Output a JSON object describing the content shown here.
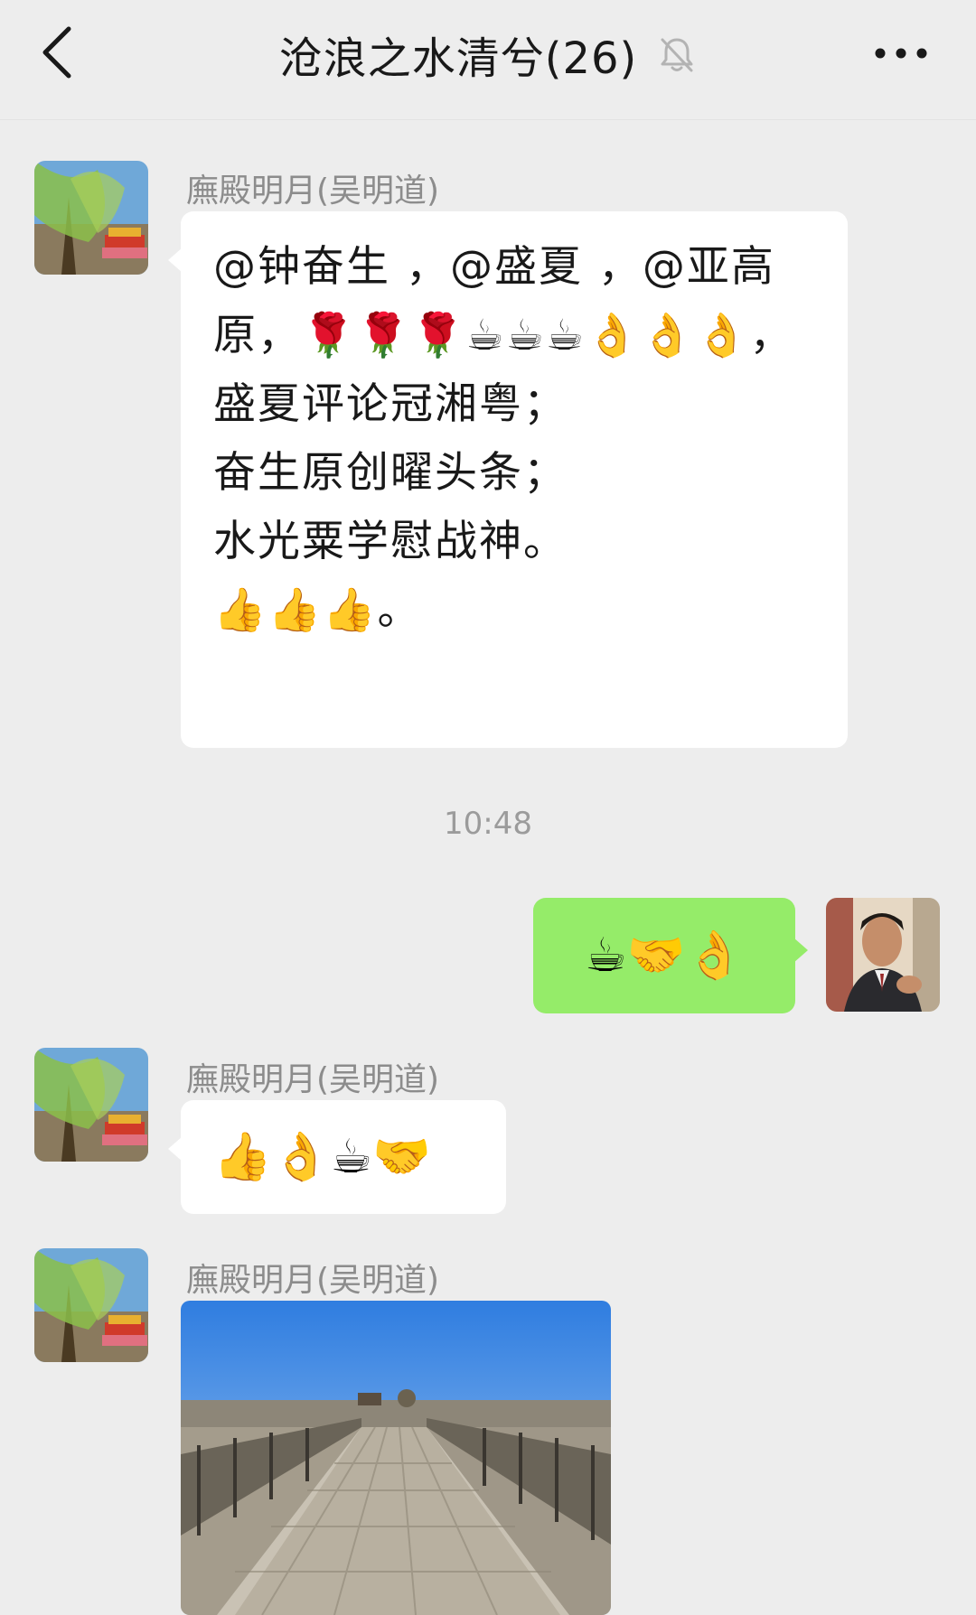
{
  "header": {
    "title": "沧浪之水清兮(26)",
    "back_icon": "chevron-left-icon",
    "mute_icon": "bell-off-icon",
    "more_icon": "more-dots-icon"
  },
  "messages": [
    {
      "sender": "廡殿明月(吴明道)",
      "text": "@钟奋生 ，@盛夏 ，@亚高原，🌹🌹🌹☕☕☕👌👌👌，\n盛夏评论冠湘粤；\n奋生原创曜头条；\n水光粟学慰战神。\n👍👍👍。"
    },
    {
      "timestamp": "10:48"
    },
    {
      "sender": "me",
      "text": "☕🤝👌"
    },
    {
      "sender": "廡殿明月(吴明道)",
      "text": "👍👌☕🤝"
    },
    {
      "sender": "廡殿明月(吴明道)",
      "type": "image"
    }
  ],
  "colors": {
    "background": "#ededed",
    "bubble_incoming": "#ffffff",
    "bubble_outgoing": "#95ec69",
    "name_gray": "#8c8c8c"
  }
}
